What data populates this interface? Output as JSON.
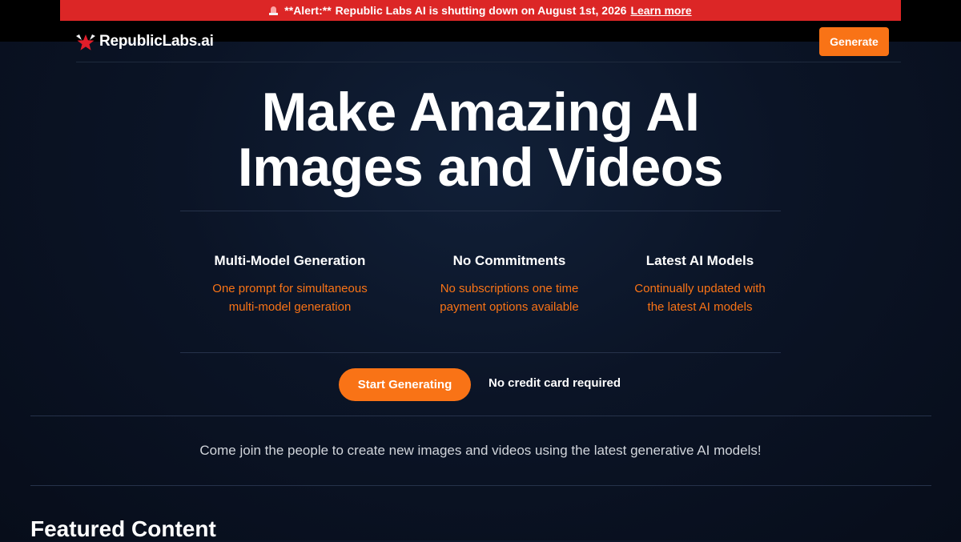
{
  "alert": {
    "prefix": "**Alert:**",
    "message": "Republic Labs AI is shutting down on August 1st, 2026",
    "link": "Learn more",
    "color": "#dc2626"
  },
  "nav": {
    "brand": "RepublicLabs.ai",
    "generate_label": "Generate",
    "accent": "#f97316"
  },
  "hero": {
    "title_line1": "Make Amazing AI",
    "title_line2": "Images and Videos"
  },
  "features": [
    {
      "title": "Multi-Model Generation",
      "line1": "One prompt for simultaneous",
      "line2": "multi-model generation"
    },
    {
      "title": "No Commitments",
      "line1": "No subscriptions one time",
      "line2": "payment options available"
    },
    {
      "title": "Latest AI Models",
      "line1": "Continually updated with",
      "line2": "the latest AI models"
    }
  ],
  "cta": {
    "start_label": "Start Generating",
    "note": "No credit card required"
  },
  "join_text": "Come join the people to create new images and videos using the latest generative AI models!",
  "featured_heading": "Featured Content",
  "icons": [
    "siren-icon",
    "logo-star-icon"
  ]
}
